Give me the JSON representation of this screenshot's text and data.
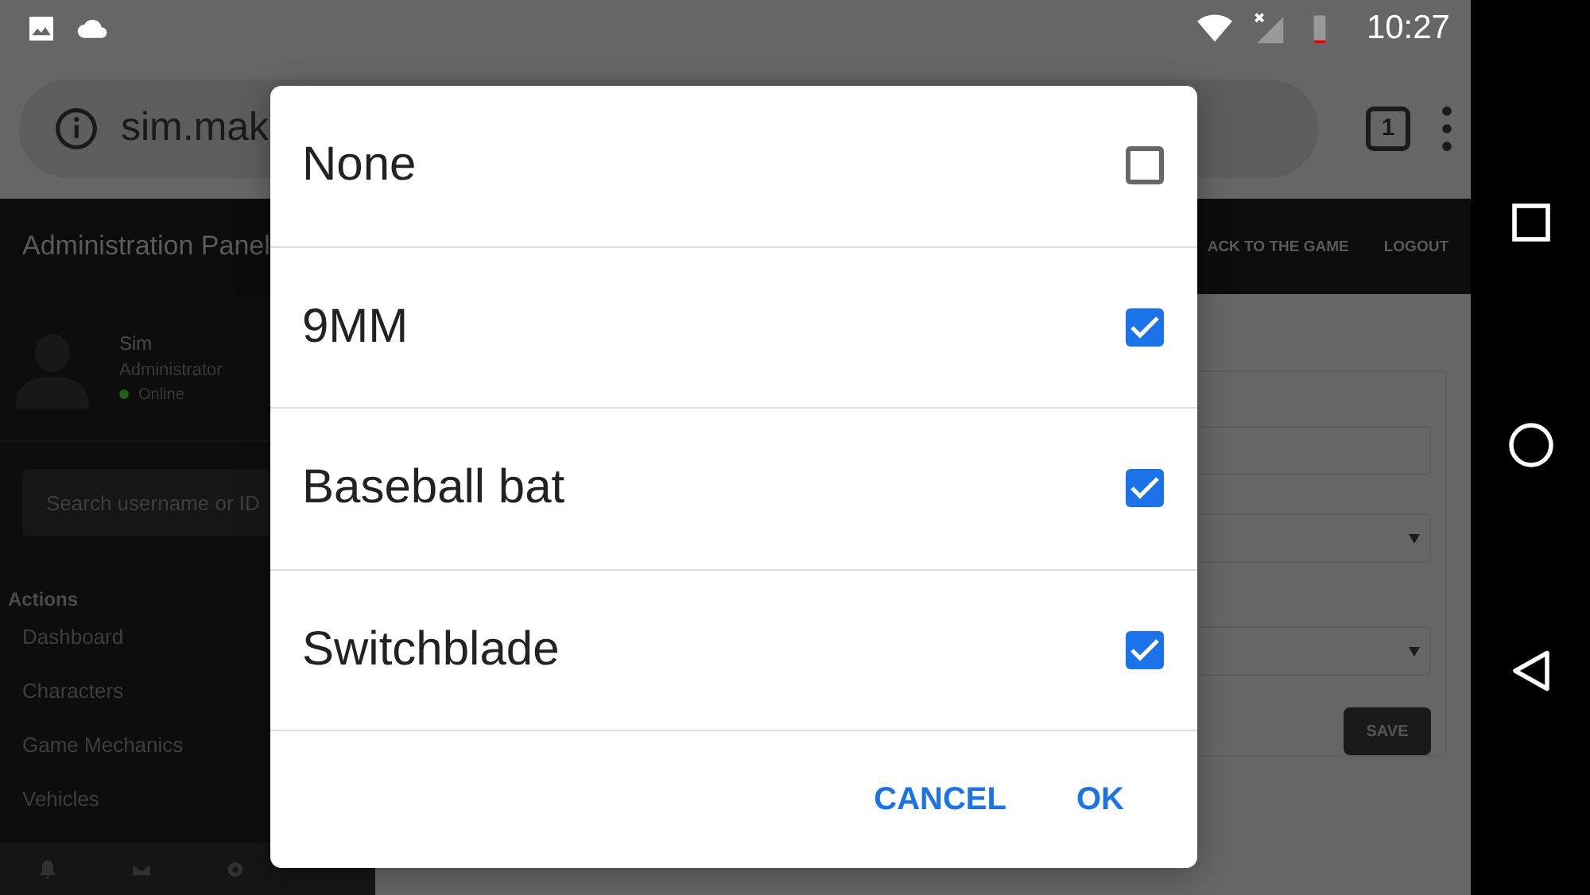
{
  "status_bar": {
    "time": "10:27"
  },
  "browser": {
    "url": "sim.mak",
    "tab_count": "1"
  },
  "header": {
    "title": "Administration Panel",
    "links": [
      "ACK TO THE GAME",
      "LOGOUT"
    ]
  },
  "sidebar": {
    "user": {
      "name": "Sim",
      "role": "Administrator",
      "status": "Online",
      "online": true
    },
    "search": {
      "placeholder": "Search username or ID"
    },
    "section": "Actions",
    "items": [
      "Dashboard",
      "Characters",
      "Game Mechanics",
      "Vehicles"
    ]
  },
  "form": {
    "button": "SAVE"
  },
  "dialog": {
    "options": [
      {
        "label": "None",
        "checked": false
      },
      {
        "label": "9MM",
        "checked": true
      },
      {
        "label": "Baseball bat",
        "checked": true
      },
      {
        "label": "Switchblade",
        "checked": true
      }
    ],
    "buttons": [
      "CANCEL",
      "OK"
    ]
  }
}
